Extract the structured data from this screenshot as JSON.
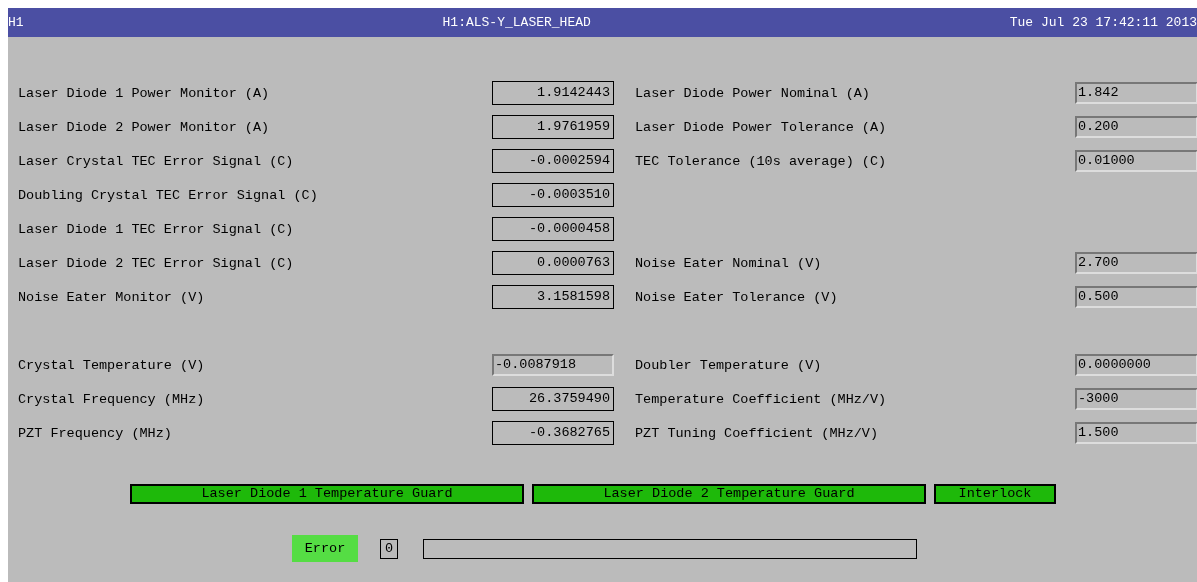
{
  "title_bar": {
    "site": "H1",
    "title": "H1:ALS-Y_LASER_HEAD",
    "timestamp": "Tue Jul 23 17:42:11 2013"
  },
  "groups": [
    [
      {
        "left": {
          "label": "Laser Diode 1 Power Monitor (A)",
          "value": "1.9142443",
          "kind": "monitor"
        },
        "right": {
          "label": "Laser Diode Power Nominal (A)",
          "value": "1.842",
          "kind": "entry"
        }
      },
      {
        "left": {
          "label": "Laser Diode 2 Power Monitor (A)",
          "value": "1.9761959",
          "kind": "monitor"
        },
        "right": {
          "label": "Laser Diode Power Tolerance (A)",
          "value": "0.200",
          "kind": "entry"
        }
      },
      {
        "left": {
          "label": "Laser Crystal TEC Error Signal (C)",
          "value": "-0.0002594",
          "kind": "monitor"
        },
        "right": {
          "label": "TEC Tolerance (10s average) (C)",
          "value": "0.01000",
          "kind": "entry"
        }
      },
      {
        "left": {
          "label": "Doubling Crystal TEC Error Signal (C)",
          "value": "-0.0003510",
          "kind": "monitor"
        }
      },
      {
        "left": {
          "label": "Laser Diode 1 TEC Error Signal (C)",
          "value": "-0.0000458",
          "kind": "monitor"
        }
      },
      {
        "left": {
          "label": "Laser Diode 2 TEC Error Signal (C)",
          "value": "0.0000763",
          "kind": "monitor"
        },
        "right": {
          "label": "Noise Eater Nominal (V)",
          "value": "2.700",
          "kind": "entry"
        }
      },
      {
        "left": {
          "label": "Noise Eater Monitor (V)",
          "value": "3.1581598",
          "kind": "monitor"
        },
        "right": {
          "label": "Noise Eater Tolerance (V)",
          "value": "0.500",
          "kind": "entry"
        }
      }
    ],
    [
      {
        "left": {
          "label": "Crystal Temperature (V)",
          "value": "-0.0087918",
          "kind": "entry"
        },
        "right": {
          "label": "Doubler Temperature (V)",
          "value": "0.0000000",
          "kind": "entry"
        }
      },
      {
        "left": {
          "label": "Crystal Frequency (MHz)",
          "value": "26.3759490",
          "kind": "monitor"
        },
        "right": {
          "label": "Temperature Coefficient (MHz/V)",
          "value": "-3000",
          "kind": "entry"
        }
      },
      {
        "left": {
          "label": "PZT Frequency (MHz)",
          "value": "-0.3682765",
          "kind": "monitor"
        },
        "right": {
          "label": "PZT Tuning Coefficient (MHz/V)",
          "value": "1.500",
          "kind": "entry"
        }
      }
    ]
  ],
  "indicators": [
    {
      "label": "Laser Diode 1 Temperature Guard",
      "on": true
    },
    {
      "label": "Laser Diode 2 Temperature Guard",
      "on": true
    },
    {
      "label": "Interlock",
      "on": true
    }
  ],
  "error": {
    "button": "Error",
    "code": "0"
  }
}
